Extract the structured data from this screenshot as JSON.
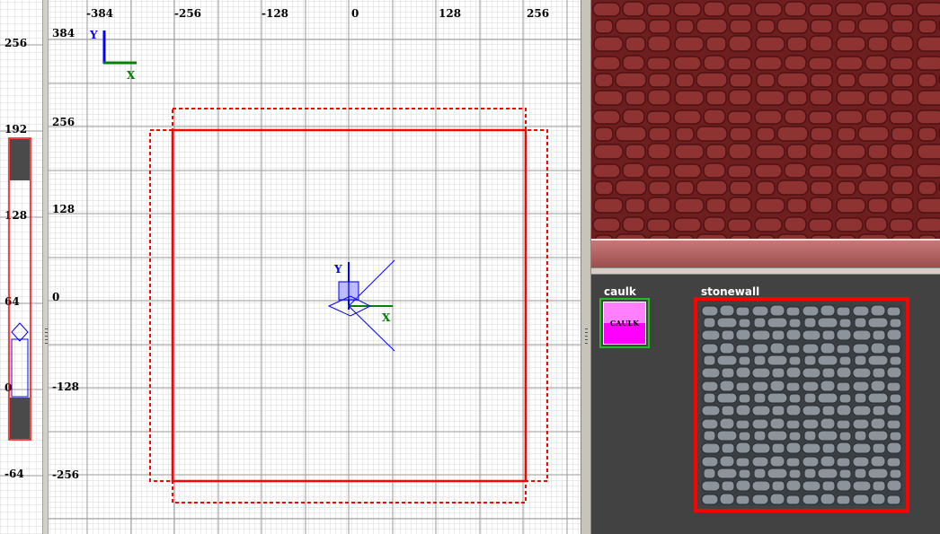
{
  "z_view": {
    "labels": [
      "256",
      "192",
      "128",
      "64",
      "0",
      "-64"
    ]
  },
  "xy_view": {
    "x_labels": [
      "-384",
      "-256",
      "-128",
      "0",
      "128",
      "256"
    ],
    "y_labels": [
      "384",
      "256",
      "128",
      "0",
      "-128",
      "-256"
    ],
    "axis_y": "Y",
    "axis_x": "X",
    "origin_axis_y": "Y",
    "origin_axis_x": "X"
  },
  "texture_browser": {
    "textures": [
      {
        "name": "caulk",
        "tile_text": "CAULK"
      },
      {
        "name": "stonewall"
      }
    ]
  },
  "colors": {
    "brush_selected": "#ff0000",
    "grid_minor": "#d9d9d9",
    "grid_major": "#9a9a9a",
    "axis_y": "#0000ff",
    "axis_x": "#008000",
    "browser_bg": "#424242"
  },
  "icons": [
    "camera-icon",
    "axis-gizmo-icon",
    "viewport-splitter-grip-icon"
  ]
}
